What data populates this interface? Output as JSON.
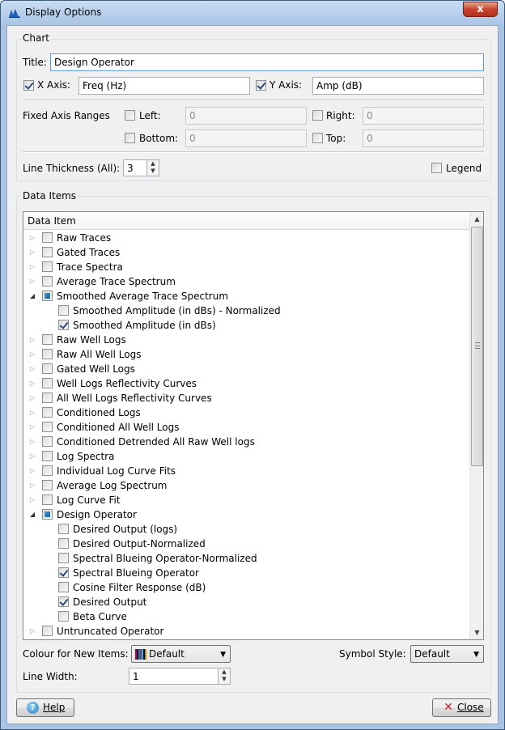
{
  "window": {
    "title": "Display Options",
    "close_glyph": "x"
  },
  "chart": {
    "group_label": "Chart",
    "title_label": "Title:",
    "title_value": "Design Operator",
    "x_axis_label": "X Axis:",
    "x_axis_checked": true,
    "x_axis_value": "Freq (Hz)",
    "y_axis_label": "Y Axis:",
    "y_axis_checked": true,
    "y_axis_value": "Amp (dB)",
    "fixed_axis_label": "Fixed Axis Ranges",
    "left_label": "Left:",
    "left_value": "0",
    "right_label": "Right:",
    "right_value": "0",
    "bottom_label": "Bottom:",
    "bottom_value": "0",
    "top_label": "Top:",
    "top_value": "0",
    "line_thickness_label": "Line Thickness (All):",
    "line_thickness_value": "3",
    "legend_label": "Legend"
  },
  "data_items": {
    "group_label": "Data Items",
    "column_header": "Data Item",
    "rows": [
      {
        "label": "Raw Traces",
        "level": 0,
        "expander": "collapsed",
        "state": "unchecked"
      },
      {
        "label": "Gated Traces",
        "level": 0,
        "expander": "collapsed",
        "state": "unchecked"
      },
      {
        "label": "Trace Spectra",
        "level": 0,
        "expander": "collapsed",
        "state": "unchecked"
      },
      {
        "label": "Average Trace Spectrum",
        "level": 0,
        "expander": "collapsed",
        "state": "unchecked"
      },
      {
        "label": "Smoothed Average Trace Spectrum",
        "level": 0,
        "expander": "expanded",
        "state": "partial"
      },
      {
        "label": "Smoothed Amplitude (in dBs) - Normalized",
        "level": 1,
        "expander": "none",
        "state": "unchecked"
      },
      {
        "label": "Smoothed Amplitude (in dBs)",
        "level": 1,
        "expander": "none",
        "state": "checked"
      },
      {
        "label": "Raw Well Logs",
        "level": 0,
        "expander": "collapsed",
        "state": "unchecked"
      },
      {
        "label": "Raw All Well Logs",
        "level": 0,
        "expander": "collapsed",
        "state": "unchecked"
      },
      {
        "label": "Gated Well Logs",
        "level": 0,
        "expander": "collapsed",
        "state": "unchecked"
      },
      {
        "label": "Well Logs Reflectivity Curves",
        "level": 0,
        "expander": "collapsed",
        "state": "unchecked"
      },
      {
        "label": "All Well Logs Reflectivity Curves",
        "level": 0,
        "expander": "collapsed",
        "state": "unchecked"
      },
      {
        "label": "Conditioned Logs",
        "level": 0,
        "expander": "collapsed",
        "state": "unchecked"
      },
      {
        "label": "Conditioned All Well Logs",
        "level": 0,
        "expander": "collapsed",
        "state": "unchecked"
      },
      {
        "label": "Conditioned Detrended All Raw Well logs",
        "level": 0,
        "expander": "collapsed",
        "state": "unchecked"
      },
      {
        "label": "Log Spectra",
        "level": 0,
        "expander": "collapsed",
        "state": "unchecked"
      },
      {
        "label": "Individual Log Curve Fits",
        "level": 0,
        "expander": "collapsed",
        "state": "unchecked"
      },
      {
        "label": "Average Log Spectrum",
        "level": 0,
        "expander": "collapsed",
        "state": "unchecked"
      },
      {
        "label": "Log Curve Fit",
        "level": 0,
        "expander": "collapsed",
        "state": "unchecked"
      },
      {
        "label": "Design Operator",
        "level": 0,
        "expander": "expanded",
        "state": "partial"
      },
      {
        "label": "Desired Output (logs)",
        "level": 1,
        "expander": "none",
        "state": "unchecked"
      },
      {
        "label": "Desired Output-Normalized",
        "level": 1,
        "expander": "none",
        "state": "unchecked"
      },
      {
        "label": "Spectral Blueing Operator-Normalized",
        "level": 1,
        "expander": "none",
        "state": "unchecked"
      },
      {
        "label": "Spectral Blueing Operator",
        "level": 1,
        "expander": "none",
        "state": "checked"
      },
      {
        "label": "Cosine Filter Response (dB)",
        "level": 1,
        "expander": "none",
        "state": "unchecked"
      },
      {
        "label": "Desired Output",
        "level": 1,
        "expander": "none",
        "state": "checked"
      },
      {
        "label": "Beta Curve",
        "level": 1,
        "expander": "none",
        "state": "unchecked"
      },
      {
        "label": "Untruncated Operator",
        "level": 0,
        "expander": "collapsed",
        "state": "unchecked"
      }
    ],
    "colour_label": "Colour for New Items:",
    "colour_value": "Default",
    "symbol_label": "Symbol Style:",
    "symbol_value": "Default",
    "line_width_label": "Line Width:",
    "line_width_value": "1"
  },
  "footer": {
    "help_label": "Help",
    "close_label": "Close"
  }
}
